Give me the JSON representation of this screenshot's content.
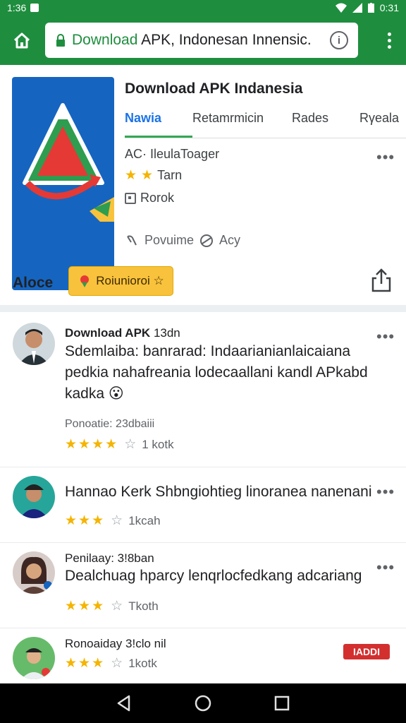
{
  "status": {
    "time": "1:36",
    "battery": "0:31"
  },
  "browser": {
    "url_host": "Download",
    "url_rest": " APK, Indonesan Innensic.",
    "icons": [
      "home-icon",
      "lock-icon",
      "info-icon",
      "overflow-menu-icon"
    ]
  },
  "app": {
    "title": "Download APK Indanesia",
    "tabs": [
      "Nawia",
      "Retamrmicin",
      "Rades",
      "Rγeala"
    ],
    "developer": "AC· IleulaToager",
    "rating_label": "Tarn",
    "category": "Rorok",
    "permissions": "Povuime",
    "age": "Acy",
    "stars_filled": 2
  },
  "about": {
    "label": "Aloce",
    "badge": "Roiunioroi ☆"
  },
  "reviews": [
    {
      "author": "Download APK",
      "time": "13dn",
      "body": "Sdemlaiba: banrarad: Indaarianianlaicaiana pedkia nahafreania lodecaallani kandl APkabd kadka 😮",
      "sub": "Ponoatie: 23dbaiii",
      "stars": 4,
      "count": "1 kotk"
    },
    {
      "author": "",
      "time": "",
      "body": "Hannao Kerk Shbngiohtieg linoranea nanenani",
      "sub": "",
      "stars": 3,
      "count": "1kcah"
    },
    {
      "author": "Penilaay:",
      "time": "3!8ban",
      "body": "Dealchuag hparcy lenqrlocfedkang adcariang",
      "sub": "",
      "stars": 3,
      "count": "Tkoth"
    },
    {
      "author": "Ronoaiday",
      "time": "3!clo nil",
      "body": "",
      "sub": "",
      "stars": 3,
      "count": "1kotk",
      "tag": "IADDI"
    }
  ],
  "colors": {
    "brand_green": "#1e8e3e",
    "star": "#f4b400",
    "badge": "#f9c23c",
    "tag_red": "#d32f2f"
  }
}
